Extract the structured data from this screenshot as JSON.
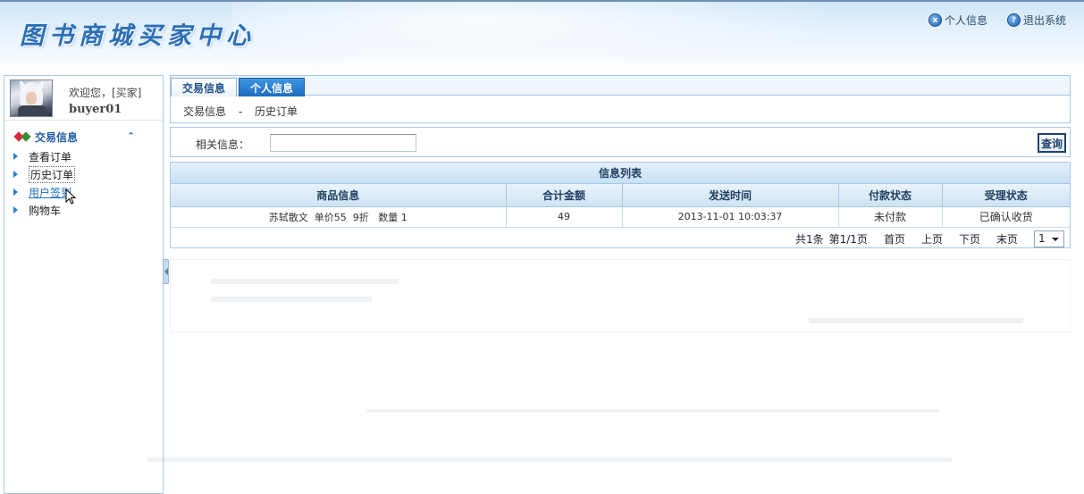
{
  "app": {
    "title": "图书商城买家中心"
  },
  "top_links": [
    {
      "label": "个人信息",
      "icon": "close-circle-icon",
      "glyph": "x"
    },
    {
      "label": "退出系统",
      "icon": "help-circle-icon",
      "glyph": "?"
    }
  ],
  "sidebar": {
    "welcome": "欢迎您，[买家]",
    "username": "buyer01",
    "section_label": "交易信息",
    "items": [
      {
        "label": "查看订单"
      },
      {
        "label": "历史订单"
      },
      {
        "label": "用户签到"
      },
      {
        "label": "购物车"
      }
    ]
  },
  "tabs": [
    {
      "label": "交易信息",
      "active": true
    },
    {
      "label": "个人信息",
      "active": false
    }
  ],
  "breadcrumb": {
    "section": "交易信息",
    "separator": "-",
    "page": "历史订单"
  },
  "search": {
    "label": "相关信息：",
    "value": "",
    "button_label": "查询"
  },
  "table": {
    "caption": "信息列表",
    "columns": [
      "商品信息",
      "合计金额",
      "发送时间",
      "付款状态",
      "受理状态"
    ],
    "rows": [
      {
        "product": "苏轼散文  单价55  9折   数量 1",
        "amount": "49",
        "sent_time": "2013-11-01 10:03:37",
        "payment_status": "未付款",
        "handle_status": "已确认收货"
      }
    ]
  },
  "pager": {
    "total": "共1条",
    "page_info": "第1/1页",
    "first": "首页",
    "prev": "上页",
    "next": "下页",
    "last": "末页",
    "selected_page": "1"
  },
  "colors": {
    "accent": "#2d6fb5",
    "border": "#a9c7e3",
    "active_tab": "#1d6cc0"
  }
}
